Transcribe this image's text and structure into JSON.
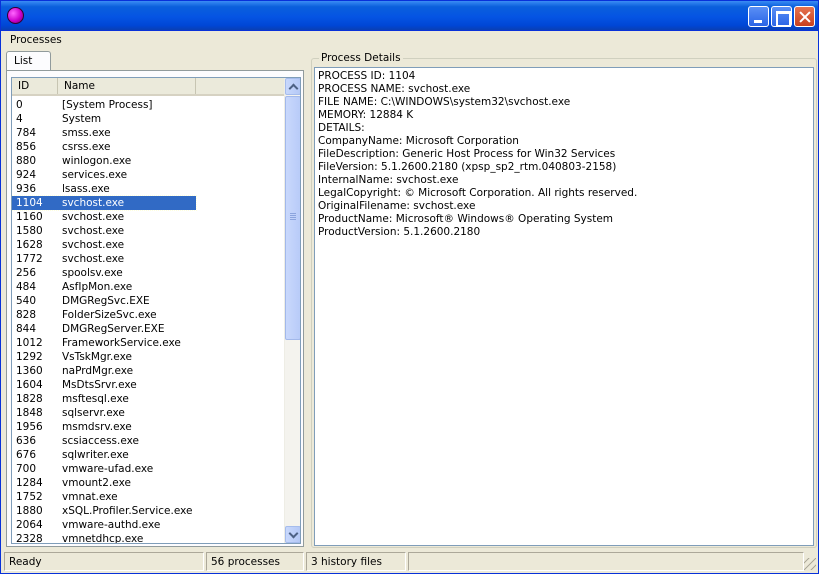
{
  "window": {
    "title": ""
  },
  "menu": {
    "processes": "Processes"
  },
  "tabs": {
    "list": "List"
  },
  "list": {
    "columns": {
      "id": "ID",
      "name": "Name",
      "blank": ""
    },
    "rows": [
      {
        "id": "0",
        "name": "[System Process]"
      },
      {
        "id": "4",
        "name": "System"
      },
      {
        "id": "784",
        "name": "smss.exe"
      },
      {
        "id": "856",
        "name": "csrss.exe"
      },
      {
        "id": "880",
        "name": "winlogon.exe"
      },
      {
        "id": "924",
        "name": "services.exe"
      },
      {
        "id": "936",
        "name": "lsass.exe"
      },
      {
        "id": "1104",
        "name": "svchost.exe",
        "selected": true
      },
      {
        "id": "1160",
        "name": "svchost.exe"
      },
      {
        "id": "1580",
        "name": "svchost.exe"
      },
      {
        "id": "1628",
        "name": "svchost.exe"
      },
      {
        "id": "1772",
        "name": "svchost.exe"
      },
      {
        "id": "256",
        "name": "spoolsv.exe"
      },
      {
        "id": "484",
        "name": "AsfIpMon.exe"
      },
      {
        "id": "540",
        "name": "DMGRegSvc.EXE"
      },
      {
        "id": "828",
        "name": "FolderSizeSvc.exe"
      },
      {
        "id": "844",
        "name": "DMGRegServer.EXE"
      },
      {
        "id": "1012",
        "name": "FrameworkService.exe"
      },
      {
        "id": "1292",
        "name": "VsTskMgr.exe"
      },
      {
        "id": "1360",
        "name": "naPrdMgr.exe"
      },
      {
        "id": "1604",
        "name": "MsDtsSrvr.exe"
      },
      {
        "id": "1828",
        "name": "msftesql.exe"
      },
      {
        "id": "1848",
        "name": "sqlservr.exe"
      },
      {
        "id": "1956",
        "name": "msmdsrv.exe"
      },
      {
        "id": "636",
        "name": "scsiaccess.exe"
      },
      {
        "id": "676",
        "name": "sqlwriter.exe"
      },
      {
        "id": "700",
        "name": "vmware-ufad.exe"
      },
      {
        "id": "1284",
        "name": "vmount2.exe"
      },
      {
        "id": "1752",
        "name": "vmnat.exe"
      },
      {
        "id": "1880",
        "name": "xSQL.Profiler.Service.exe"
      },
      {
        "id": "2064",
        "name": "vmware-authd.exe"
      },
      {
        "id": "2328",
        "name": "vmnetdhcp.exe"
      }
    ]
  },
  "details": {
    "legend": "Process Details",
    "lines": [
      "PROCESS ID: 1104",
      "PROCESS NAME: svchost.exe",
      "FILE NAME: C:\\WINDOWS\\system32\\svchost.exe",
      "MEMORY: 12884 K",
      "DETAILS:",
      "CompanyName: Microsoft Corporation",
      "FileDescription: Generic Host Process for Win32 Services",
      "FileVersion: 5.1.2600.2180 (xpsp_sp2_rtm.040803-2158)",
      "InternalName: svchost.exe",
      "LegalCopyright: © Microsoft Corporation. All rights reserved.",
      "OriginalFilename: svchost.exe",
      "ProductName: Microsoft® Windows® Operating System",
      "ProductVersion: 5.1.2600.2180"
    ]
  },
  "status": {
    "state": "Ready",
    "processes": "56 processes",
    "history": "3 history files",
    "extra": ""
  },
  "colors": {
    "titlebar": "#0554e3",
    "selection": "#316ac5",
    "window_bg": "#ece9d8"
  }
}
